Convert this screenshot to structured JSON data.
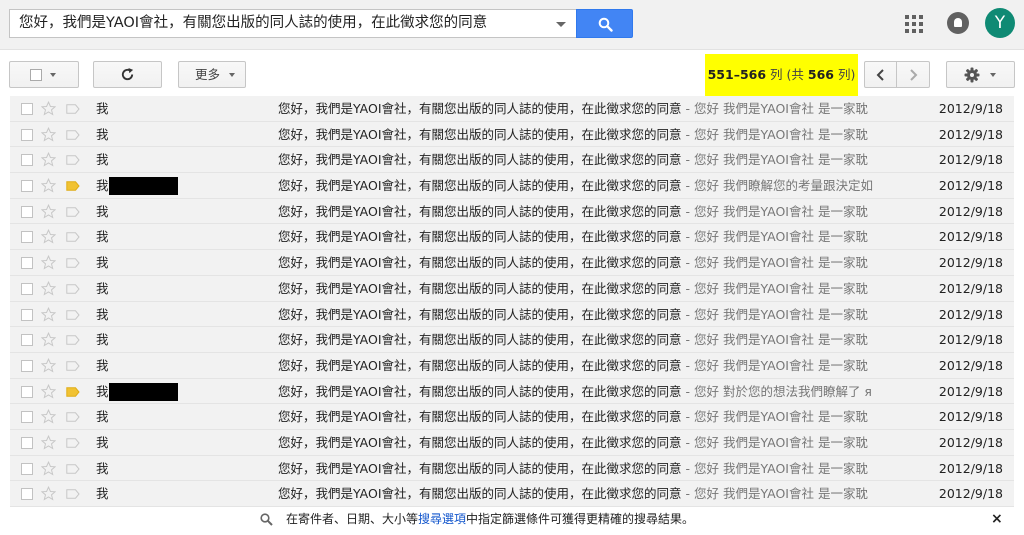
{
  "search": {
    "query": "您好，我們是YAOI會社，有關您出版的同人誌的使用，在此徵求您的同意"
  },
  "account": {
    "avatar_letter": "Y",
    "avatar_color": "#0f8a74"
  },
  "toolbar": {
    "more_label": "更多",
    "pager": {
      "range": "551–566",
      "unit": "列",
      "total_prefix": "(共",
      "total": "566",
      "total_suffix": "列)"
    }
  },
  "colors": {
    "search_button": "#4285f4",
    "pager_highlight": "#ffff00",
    "row_bg": "#f2f2f2"
  },
  "emails": [
    {
      "sender": "我",
      "redacted": false,
      "tagged": false,
      "subject": "您好，我們是YAOI會社，有關您出版的同人誌的使用，在此徵求您的同意",
      "snippet": " - 您好 我們是YAOI會社 是一家耽",
      "date": "2012/9/18"
    },
    {
      "sender": "我",
      "redacted": false,
      "tagged": false,
      "subject": "您好，我們是YAOI會社，有關您出版的同人誌的使用，在此徵求您的同意",
      "snippet": " - 您好 我們是YAOI會社 是一家耽",
      "date": "2012/9/18"
    },
    {
      "sender": "我",
      "redacted": false,
      "tagged": false,
      "subject": "您好，我們是YAOI會社，有關您出版的同人誌的使用，在此徵求您的同意",
      "snippet": " - 您好 我們是YAOI會社 是一家耽",
      "date": "2012/9/18"
    },
    {
      "sender": "我",
      "redacted": true,
      "tagged": true,
      "subject": "您好，我們是YAOI會社，有關您出版的同人誌的使用，在此徵求您的同意",
      "snippet": " - 您好 我們瞭解您的考量跟決定如",
      "date": "2012/9/18"
    },
    {
      "sender": "我",
      "redacted": false,
      "tagged": false,
      "subject": "您好，我們是YAOI會社，有關您出版的同人誌的使用，在此徵求您的同意",
      "snippet": " - 您好 我們是YAOI會社 是一家耽",
      "date": "2012/9/18"
    },
    {
      "sender": "我",
      "redacted": false,
      "tagged": false,
      "subject": "您好，我們是YAOI會社，有關您出版的同人誌的使用，在此徵求您的同意",
      "snippet": " - 您好 我們是YAOI會社 是一家耽",
      "date": "2012/9/18"
    },
    {
      "sender": "我",
      "redacted": false,
      "tagged": false,
      "subject": "您好，我們是YAOI會社，有關您出版的同人誌的使用，在此徵求您的同意",
      "snippet": " - 您好 我們是YAOI會社 是一家耽",
      "date": "2012/9/18"
    },
    {
      "sender": "我",
      "redacted": false,
      "tagged": false,
      "subject": "您好，我們是YAOI會社，有關您出版的同人誌的使用，在此徵求您的同意",
      "snippet": " - 您好 我們是YAOI會社 是一家耽",
      "date": "2012/9/18"
    },
    {
      "sender": "我",
      "redacted": false,
      "tagged": false,
      "subject": "您好，我們是YAOI會社，有關您出版的同人誌的使用，在此徵求您的同意",
      "snippet": " - 您好 我們是YAOI會社 是一家耽",
      "date": "2012/9/18"
    },
    {
      "sender": "我",
      "redacted": false,
      "tagged": false,
      "subject": "您好，我們是YAOI會社，有關您出版的同人誌的使用，在此徵求您的同意",
      "snippet": " - 您好 我們是YAOI會社 是一家耽",
      "date": "2012/9/18"
    },
    {
      "sender": "我",
      "redacted": false,
      "tagged": false,
      "subject": "您好，我們是YAOI會社，有關您出版的同人誌的使用，在此徵求您的同意",
      "snippet": " - 您好 我們是YAOI會社 是一家耽",
      "date": "2012/9/18"
    },
    {
      "sender": "我",
      "redacted": true,
      "tagged": true,
      "subject": "您好，我們是YAOI會社，有關您出版的同人誌的使用，在此徵求您的同意",
      "snippet": " - 您好 對於您的想法我們瞭解了 я",
      "date": "2012/9/18"
    },
    {
      "sender": "我",
      "redacted": false,
      "tagged": false,
      "subject": "您好，我們是YAOI會社，有關您出版的同人誌的使用，在此徵求您的同意",
      "snippet": " - 您好 我們是YAOI會社 是一家耽",
      "date": "2012/9/18"
    },
    {
      "sender": "我",
      "redacted": false,
      "tagged": false,
      "subject": "您好，我們是YAOI會社，有關您出版的同人誌的使用，在此徵求您的同意",
      "snippet": " - 您好 我們是YAOI會社 是一家耽",
      "date": "2012/9/18"
    },
    {
      "sender": "我",
      "redacted": false,
      "tagged": false,
      "subject": "您好，我們是YAOI會社，有關您出版的同人誌的使用，在此徵求您的同意",
      "snippet": " - 您好 我們是YAOI會社 是一家耽",
      "date": "2012/9/18"
    },
    {
      "sender": "我",
      "redacted": false,
      "tagged": false,
      "subject": "您好，我們是YAOI會社，有關您出版的同人誌的使用，在此徵求您的同意",
      "snippet": " - 您好 我們是YAOI會社 是一家耽",
      "date": "2012/9/18"
    }
  ],
  "footer": {
    "text_before": "在寄件者、日期、大小等",
    "link": "搜尋選項",
    "text_after": "中指定篩選條件可獲得更精確的搜尋結果。",
    "close": "×"
  }
}
